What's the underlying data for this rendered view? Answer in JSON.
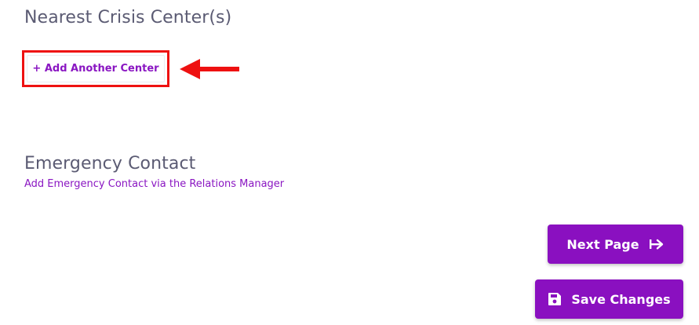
{
  "sections": {
    "crisis": {
      "title": "Nearest Crisis Center(s)",
      "add_button_label": "+ Add Another Center"
    },
    "emergency": {
      "title": "Emergency Contact",
      "subtitle": "Add Emergency Contact via the Relations Manager"
    }
  },
  "actions": {
    "next_label": "Next Page",
    "save_label": "Save Changes"
  },
  "icons": {
    "next": "arrow-right-to-bar-icon",
    "save": "floppy-disk-icon",
    "annotation": "red-arrow-icon"
  },
  "colors": {
    "accent": "#8a10c0",
    "annotation": "#ee1111",
    "heading": "#5b5b73"
  }
}
